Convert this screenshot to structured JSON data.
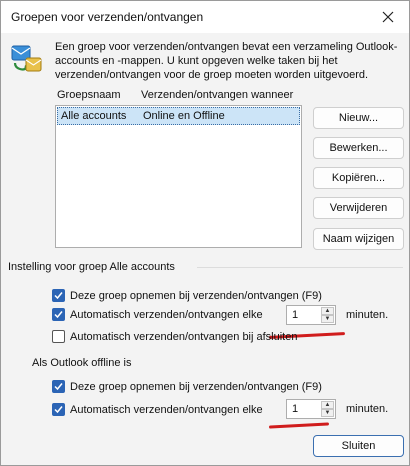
{
  "window": {
    "title": "Groepen voor verzenden/ontvangen"
  },
  "intro": {
    "description": "Een groep voor verzenden/ontvangen bevat een verzameling Outlook-accounts en -mappen. U kunt opgeven welke taken bij het verzenden/ontvangen voor de groep moeten worden uitgevoerd."
  },
  "group_list": {
    "columns": [
      "Groepsnaam",
      "Verzenden/ontvangen wanneer"
    ],
    "rows": [
      {
        "name": "Alle accounts",
        "when": "Online en Offline",
        "selected": true
      }
    ]
  },
  "buttons": {
    "new": "Nieuw...",
    "edit": "Bewerken...",
    "copy": "Kopiëren...",
    "delete": "Verwijderen",
    "rename": "Naam wijzigen",
    "close": "Sluiten"
  },
  "settings_online": {
    "title": "Instelling voor groep Alle accounts",
    "include": {
      "label": "Deze groep opnemen bij verzenden/ontvangen (F9)",
      "checked": true
    },
    "auto": {
      "label": "Automatisch verzenden/ontvangen elke",
      "checked": true,
      "value": "1",
      "unit": "minuten."
    },
    "on_exit": {
      "label": "Automatisch verzenden/ontvangen bij afsluiten",
      "checked": false
    }
  },
  "settings_offline": {
    "title": "Als Outlook offline is",
    "include": {
      "label": "Deze groep opnemen bij verzenden/ontvangen (F9)",
      "checked": true
    },
    "auto": {
      "label": "Automatisch verzenden/ontvangen elke",
      "checked": true,
      "value": "1",
      "unit": "minuten."
    }
  },
  "colors": {
    "accent": "#2b64b5",
    "selection": "#cce4f7",
    "annotation": "#d01c1c"
  },
  "icons": {
    "app": "send-receive-icon",
    "close": "close-icon",
    "check": "check-icon"
  }
}
